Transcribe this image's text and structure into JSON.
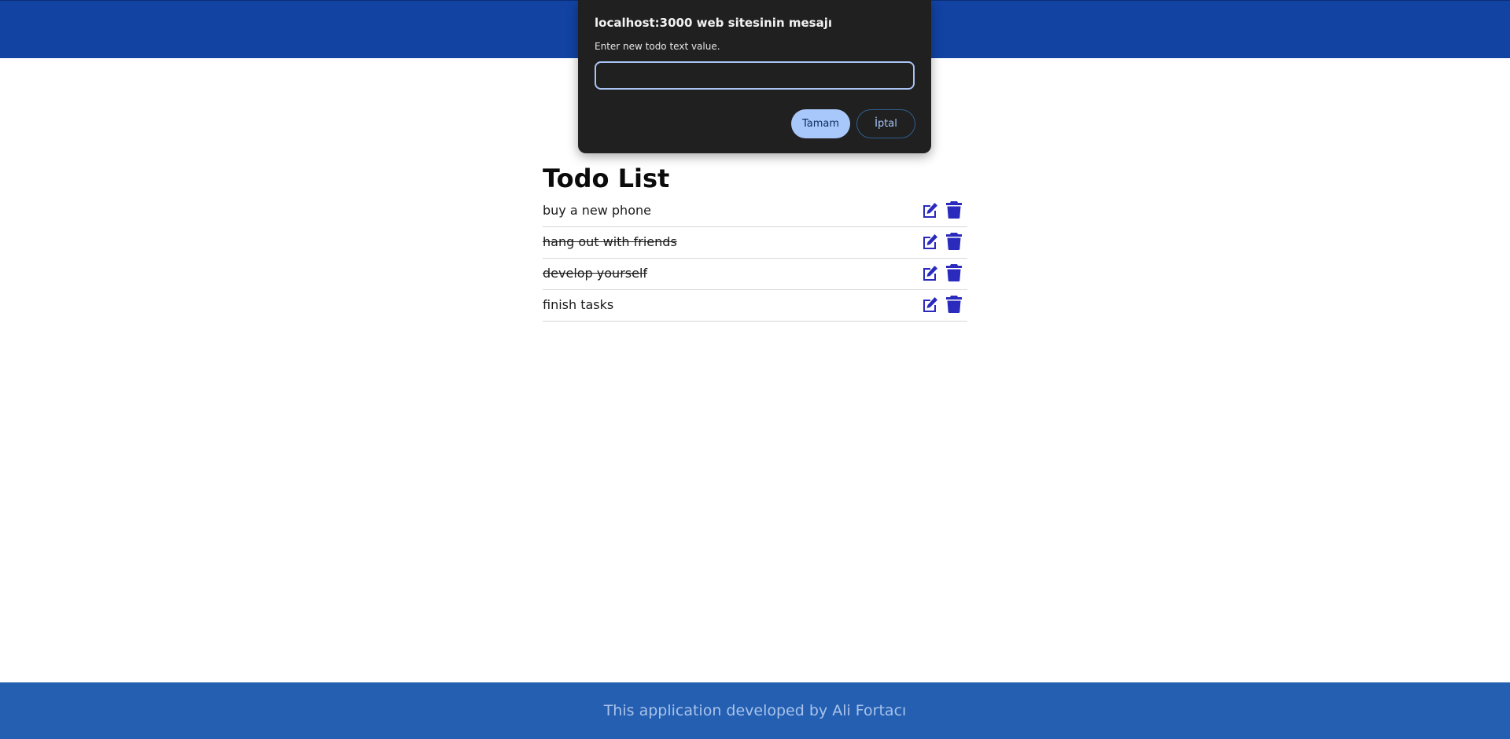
{
  "header": {
    "color": "#1243a3"
  },
  "main": {
    "title": "Todo List",
    "todos": [
      {
        "text": "buy a new phone",
        "completed": false
      },
      {
        "text": "hang out with friends",
        "completed": true
      },
      {
        "text": "develop yourself",
        "completed": true
      },
      {
        "text": "finish tasks",
        "completed": false
      }
    ],
    "action_icons": [
      "edit-icon",
      "trash-icon"
    ],
    "icon_color": "#2a2bbd"
  },
  "footer": {
    "text": "This application developed by Ali Fortacı",
    "color": "#245fb2"
  },
  "dialog": {
    "title": "localhost:3000 web sitesinin mesajı",
    "message": "Enter new todo text value.",
    "input_value": "",
    "ok_label": "Tamam",
    "cancel_label": "İptal"
  }
}
